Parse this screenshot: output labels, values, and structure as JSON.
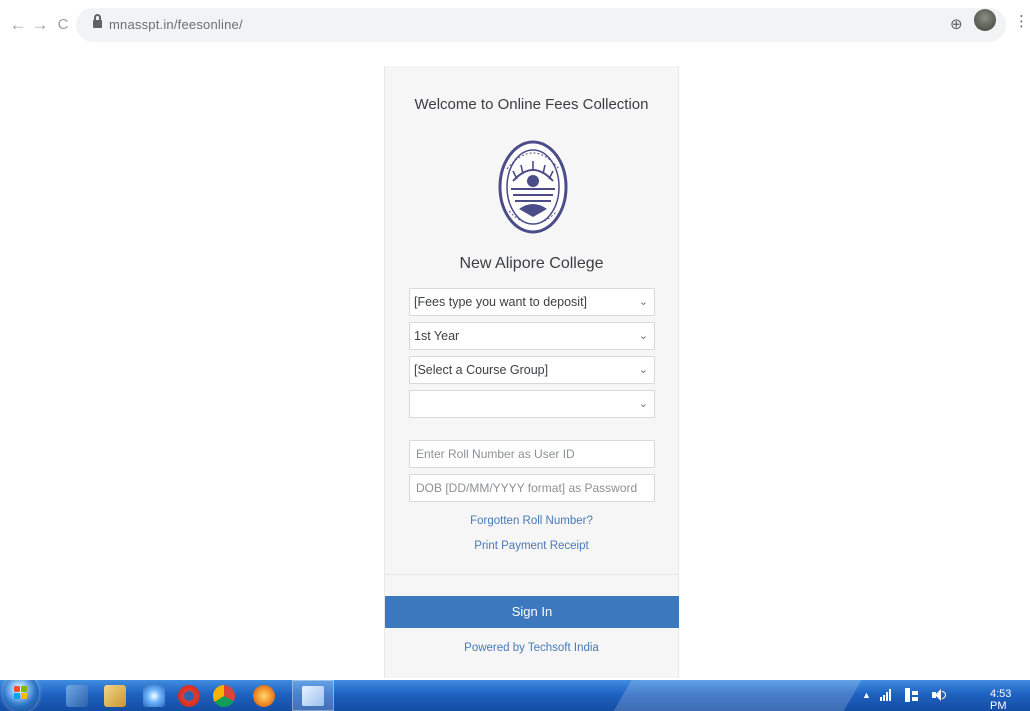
{
  "browser": {
    "url": "mnasspt.in/feesonline/",
    "back_icon": "←",
    "forward_icon": "→",
    "reload_icon": "C",
    "zoom_icon": "⊕",
    "star_icon": "☆",
    "menu_icon": "⋮"
  },
  "page": {
    "welcome": "Welcome to Online Fees Collection",
    "college_name": "New Alipore College",
    "fees_type_select": "[Fees type you want to deposit]",
    "year_select": "1st Year",
    "course_group_select": "[Select a Course Group]",
    "extra_select": "",
    "roll_placeholder": "Enter Roll Number as User ID",
    "password_placeholder": "DOB [DD/MM/YYYY format] as Password",
    "forgot_link": "Forgotten Roll Number?",
    "receipt_link": "Print Payment Receipt",
    "signin_label": "Sign In",
    "powered_by": "Powered by Techsoft India"
  },
  "taskbar": {
    "clock": "4:53 PM",
    "tray_arrow": "▲"
  },
  "colors": {
    "accent": "#3c78bd",
    "link": "#4a79b4",
    "taskbar": "#1f62c1"
  }
}
